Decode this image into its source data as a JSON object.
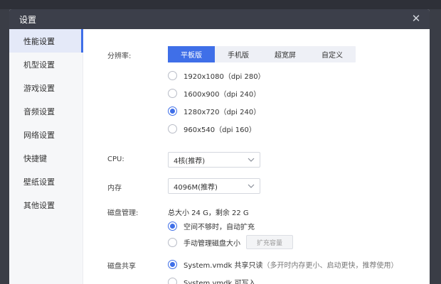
{
  "window": {
    "title": "设置",
    "close_glyph": "✕"
  },
  "sidebar": {
    "items": [
      {
        "label": "性能设置",
        "active": true
      },
      {
        "label": "机型设置"
      },
      {
        "label": "游戏设置"
      },
      {
        "label": "音频设置"
      },
      {
        "label": "网络设置"
      },
      {
        "label": "快捷键"
      },
      {
        "label": "壁纸设置"
      },
      {
        "label": "其他设置"
      }
    ]
  },
  "resolution": {
    "label": "分辨率:",
    "tabs": [
      "平板版",
      "手机版",
      "超宽屏",
      "自定义"
    ],
    "active_tab": "平板版",
    "options": [
      "1920x1080（dpi 280）",
      "1600x900（dpi 240）",
      "1280x720（dpi 240）",
      "960x540（dpi 160）"
    ],
    "selected": "1280x720（dpi 240）"
  },
  "cpu": {
    "label": "CPU:",
    "value": "4核(推荐)"
  },
  "memory": {
    "label": "内存",
    "value": "4096M(推荐)"
  },
  "disk": {
    "label": "磁盘管理:",
    "summary": "总大小 24 G，剩余 22 G",
    "options": [
      "空间不够时，自动扩充",
      "手动管理磁盘大小"
    ],
    "selected": "空间不够时，自动扩充",
    "expand_button": "扩充容量"
  },
  "disk_share": {
    "label": "磁盘共享",
    "option1": "System.vmdk 共享只读",
    "option1_hint": "（多开时内存更小、启动更快，推荐使用）",
    "option2": "System.vmdk 可写入",
    "selected": "System.vmdk 共享只读"
  },
  "colors": {
    "accent": "#3f6fe8",
    "titlebar": "#3c3f4a"
  },
  "icons": {
    "close": "close-icon",
    "dropdown": "chevron-down-icon"
  }
}
